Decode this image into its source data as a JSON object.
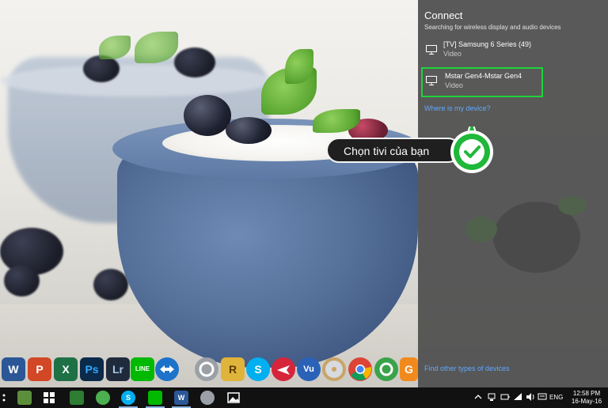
{
  "connect": {
    "title": "Connect",
    "subtitle": "Searching for wireless display and audio devices",
    "devices": [
      {
        "name": "[TV] Samsung 6 Series (49)",
        "type": "Video"
      },
      {
        "name": "Mstar Gen4-Mstar Gen4",
        "type": "Video",
        "selected": true
      }
    ],
    "where_link": "Where is my device?",
    "find_other": "Find other types of devices"
  },
  "callout": {
    "text": "Chọn tivi của bạn",
    "accent": "#1fd33c"
  },
  "dock": {
    "apps": [
      {
        "icon": "word-icon",
        "label": "W",
        "color": "#2b5797"
      },
      {
        "icon": "powerpoint-icon",
        "label": "P",
        "color": "#d24726"
      },
      {
        "icon": "excel-icon",
        "label": "X",
        "color": "#1e7145"
      },
      {
        "icon": "photoshop-icon",
        "label": "Ps",
        "color": "#0b2a4a"
      },
      {
        "icon": "lightroom-icon",
        "label": "Lr",
        "color": "#1f2b3c"
      },
      {
        "icon": "line-icon",
        "label": "LINE",
        "color": "#00b900"
      },
      {
        "icon": "teamviewer-icon",
        "label": "",
        "color": "#1d73c9"
      },
      {
        "icon": "utility-icon",
        "label": "",
        "color": "#9aa0a6"
      },
      {
        "icon": "r-app-icon",
        "label": "R",
        "color": "#e0b43a"
      },
      {
        "icon": "skype-icon",
        "label": "S",
        "color": "#00aff0"
      },
      {
        "icon": "red-app-icon",
        "label": "",
        "color": "#d6253a"
      },
      {
        "icon": "vu-app-icon",
        "label": "Vu",
        "color": "#2a62b8"
      },
      {
        "icon": "dvd-icon",
        "label": "",
        "color": "#c7a567"
      },
      {
        "icon": "chrome-icon",
        "label": "",
        "color": "#db4437"
      },
      {
        "icon": "green-app-icon",
        "label": "",
        "color": "#3aa34a"
      },
      {
        "icon": "foxit-icon",
        "label": "G",
        "color": "#f18a1d"
      }
    ]
  },
  "taskbar": {
    "lang": "ENG",
    "time": "12:58 PM",
    "date": "16-May-16"
  }
}
